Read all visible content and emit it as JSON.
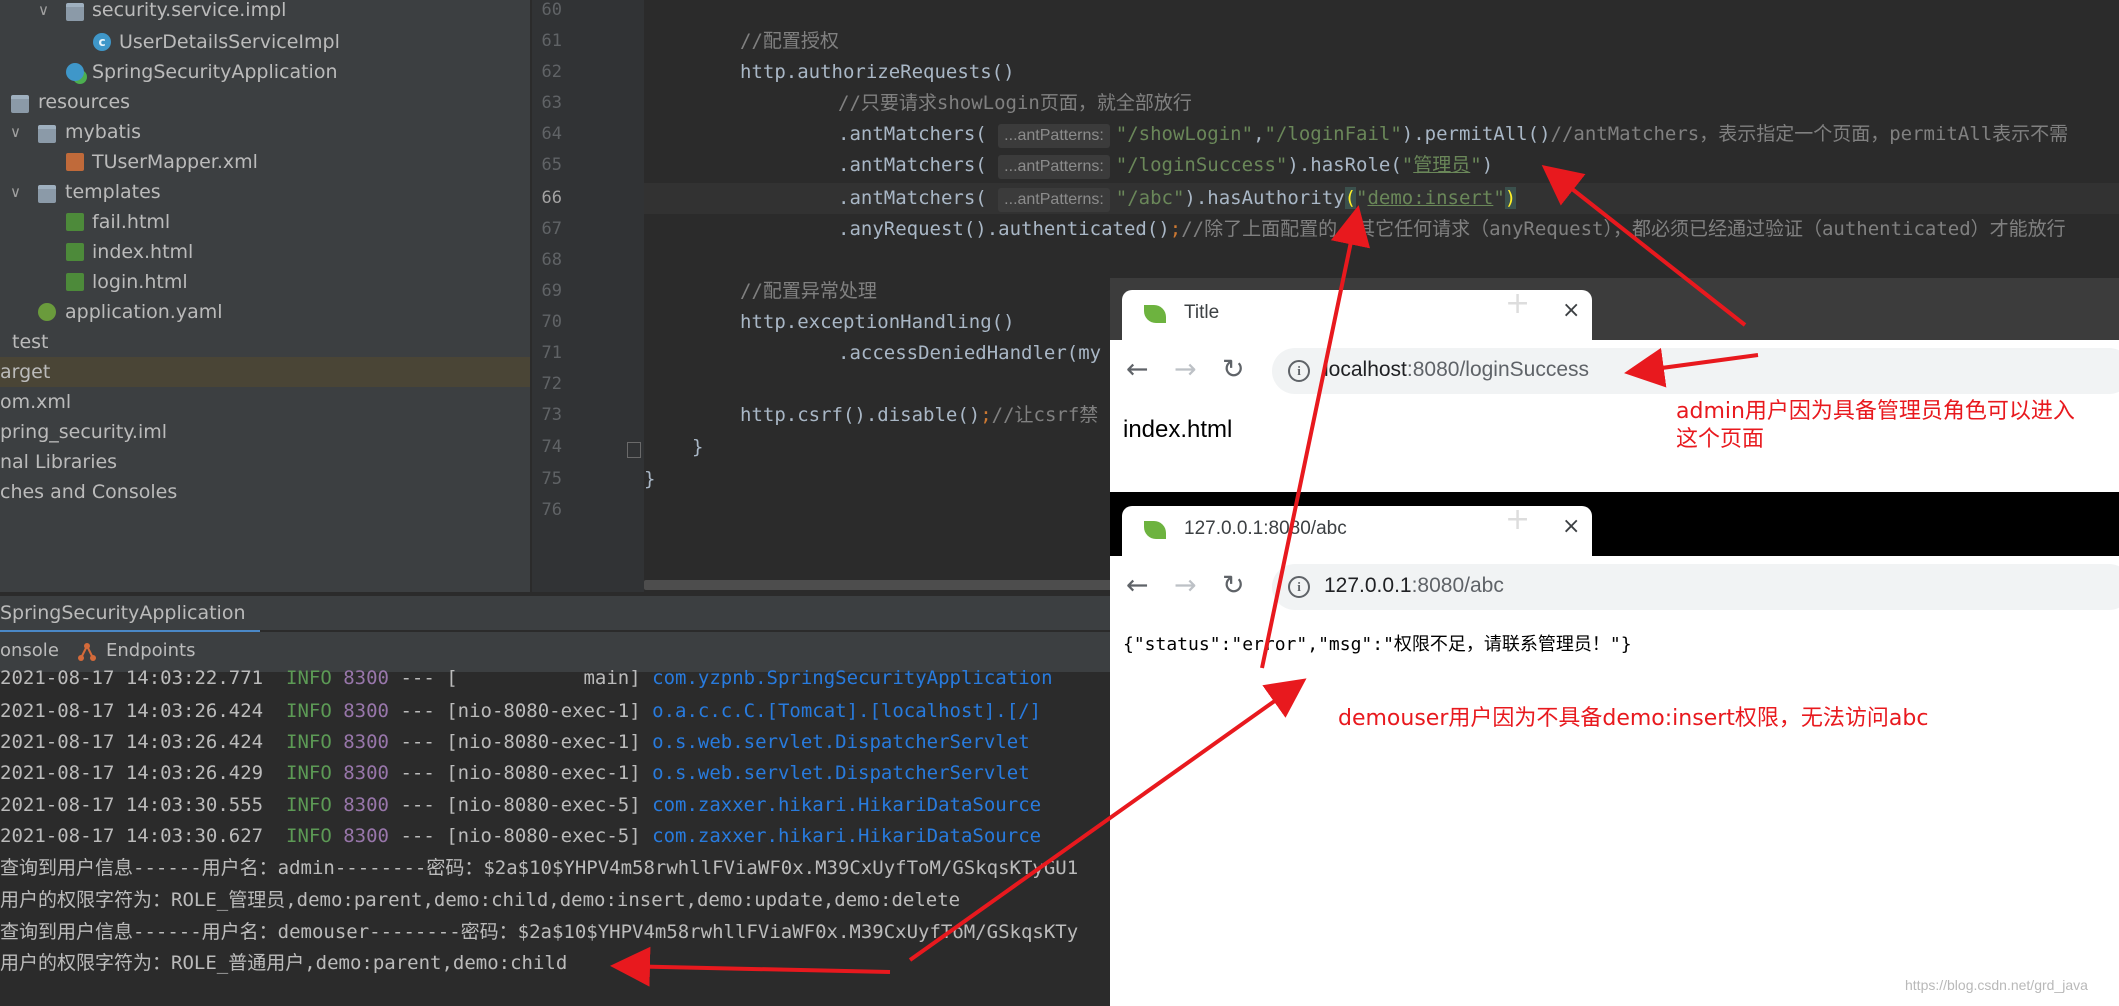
{
  "project_tree": {
    "items": [
      {
        "label": "security.service.impl",
        "icon": "package-icon"
      },
      {
        "label": "UserDetailsServiceImpl",
        "icon": "java-class-icon"
      },
      {
        "label": "SpringSecurityApplication",
        "icon": "spring-boot-class-icon"
      },
      {
        "label": "resources",
        "icon": "resources-folder-icon"
      },
      {
        "label": "mybatis",
        "icon": "folder-icon"
      },
      {
        "label": "TUserMapper.xml",
        "icon": "xml-file-icon"
      },
      {
        "label": "templates",
        "icon": "folder-icon"
      },
      {
        "label": "fail.html",
        "icon": "html-file-icon"
      },
      {
        "label": "index.html",
        "icon": "html-file-icon"
      },
      {
        "label": "login.html",
        "icon": "html-file-icon"
      },
      {
        "label": "application.yaml",
        "icon": "yaml-file-icon"
      },
      {
        "label": "test",
        "icon": ""
      },
      {
        "label": "arget",
        "icon": ""
      },
      {
        "label": "om.xml",
        "icon": ""
      },
      {
        "label": "pring_security.iml",
        "icon": ""
      },
      {
        "label": "nal Libraries",
        "icon": ""
      },
      {
        "label": "ches and Consoles",
        "icon": ""
      }
    ]
  },
  "editor": {
    "line_numbers": [
      "60",
      "61",
      "62",
      "63",
      "64",
      "65",
      "66",
      "67",
      "68",
      "69",
      "70",
      "71",
      "72",
      "73",
      "74",
      "75",
      "76"
    ],
    "current_line": "66",
    "lines": {
      "l61": "//配置授权",
      "l62": "http.authorizeRequests()",
      "l63": "//只要请求showLogin页面，就全部放行",
      "l64_a": ".antMatchers(",
      "l64_hint": "...antPatterns:",
      "l64_s1": "\"/showLogin\"",
      "l64_comma": ",",
      "l64_s2": "\"/loginFail\"",
      "l64_b": ").permitAll()",
      "l64_cm": "//antMatchers，表示指定一个页面，permitAll表示不需",
      "l65_a": ".antMatchers(",
      "l65_hint": "...antPatterns:",
      "l65_s1": "\"/loginSuccess\"",
      "l65_b": ").hasRole(",
      "l65_s2_q1": "\"",
      "l65_s2": "管理员",
      "l65_s2_q2": "\"",
      "l65_c": ")",
      "l66_a": ".antMatchers(",
      "l66_hint": "...antPatterns:",
      "l66_s1": "\"/abc\"",
      "l66_b": ").hasAuthority",
      "l66_p1": "(",
      "l66_q1": "\"",
      "l66_s2": "demo:insert",
      "l66_q2": "\"",
      "l66_p2": ")",
      "l67_a": ".anyRequest().authenticated()",
      "l67_semi": ";",
      "l67_cm": "//除了上面配置的，其它任何请求（anyRequest），都必须已经通过验证（authenticated）才能放行",
      "l69": "//配置异常处理",
      "l70": "http.exceptionHandling()",
      "l71": ".accessDeniedHandler(my",
      "l73_a": "http.csrf().disable()",
      "l73_semi": ";",
      "l73_cm": "//让csrf禁",
      "l74": "}",
      "l75": "}"
    }
  },
  "run_panel": {
    "tab_label": "SpringSecurityApplication",
    "tab_close": "×",
    "subtabs": {
      "console": "onsole",
      "endpoints": "Endpoints"
    },
    "log_lines": [
      {
        "ts": "2021-08-17 14:03:22.771",
        "lvl": "INFO",
        "pid": "8300",
        "sep": "---",
        "thread": "[           main]",
        "cls": "com.yzpnb.SpringSecurityApplication"
      },
      {
        "ts": "2021-08-17 14:03:26.424",
        "lvl": "INFO",
        "pid": "8300",
        "sep": "---",
        "thread": "[nio-8080-exec-1]",
        "cls": "o.a.c.c.C.[Tomcat].[localhost].[/]"
      },
      {
        "ts": "2021-08-17 14:03:26.424",
        "lvl": "INFO",
        "pid": "8300",
        "sep": "---",
        "thread": "[nio-8080-exec-1]",
        "cls": "o.s.web.servlet.DispatcherServlet"
      },
      {
        "ts": "2021-08-17 14:03:26.429",
        "lvl": "INFO",
        "pid": "8300",
        "sep": "---",
        "thread": "[nio-8080-exec-1]",
        "cls": "o.s.web.servlet.DispatcherServlet"
      },
      {
        "ts": "2021-08-17 14:03:30.555",
        "lvl": "INFO",
        "pid": "8300",
        "sep": "---",
        "thread": "[nio-8080-exec-5]",
        "cls": "com.zaxxer.hikari.HikariDataSource"
      },
      {
        "ts": "2021-08-17 14:03:30.627",
        "lvl": "INFO",
        "pid": "8300",
        "sep": "---",
        "thread": "[nio-8080-exec-5]",
        "cls": "com.zaxxer.hikari.HikariDataSource"
      }
    ],
    "plain_lines": [
      "查询到用户信息------用户名：admin--------密码：$2a$10$YHPV4m58rwhllFViaWF0x.M39CxUyfToM/GSkqsKTyGU1",
      "用户的权限字符为：ROLE_管理员,demo:parent,demo:child,demo:insert,demo:update,demo:delete",
      "查询到用户信息------用户名：demouser--------密码：$2a$10$YHPV4m58rwhllFViaWF0x.M39CxUyfToM/GSkqsKTy",
      "用户的权限字符为：ROLE_普通用户,demo:parent,demo:child"
    ]
  },
  "browser_1": {
    "tab_title": "Title",
    "tab_close": "×",
    "new_tab": "+",
    "back": "←",
    "forward": "→",
    "reload": "↻",
    "info": "i",
    "url_host": "localhost",
    "url_rest": ":8080/loginSuccess",
    "body_text": "index.html"
  },
  "browser_2": {
    "tab_title": "127.0.0.1:8080/abc",
    "tab_close": "×",
    "new_tab": "+",
    "back": "←",
    "forward": "→",
    "reload": "↻",
    "info": "i",
    "url_host": "127.0.0.1",
    "url_rest": ":8080/abc",
    "body_text": "{\"status\":\"error\",\"msg\":\"权限不足，请联系管理员！\"}"
  },
  "annotations": {
    "admin_note": "admin用户因为具备管理员角色可以进入这个页面",
    "demouser_note": "demouser用户因为不具备demo:insert权限，无法访问abc",
    "watermark": "https://blog.csdn.net/grd_java"
  },
  "colors": {
    "annotation_red": "#e8191e",
    "ide_background": "#2b2b2b",
    "string_green": "#6a8759",
    "comment_gray": "#808080"
  }
}
